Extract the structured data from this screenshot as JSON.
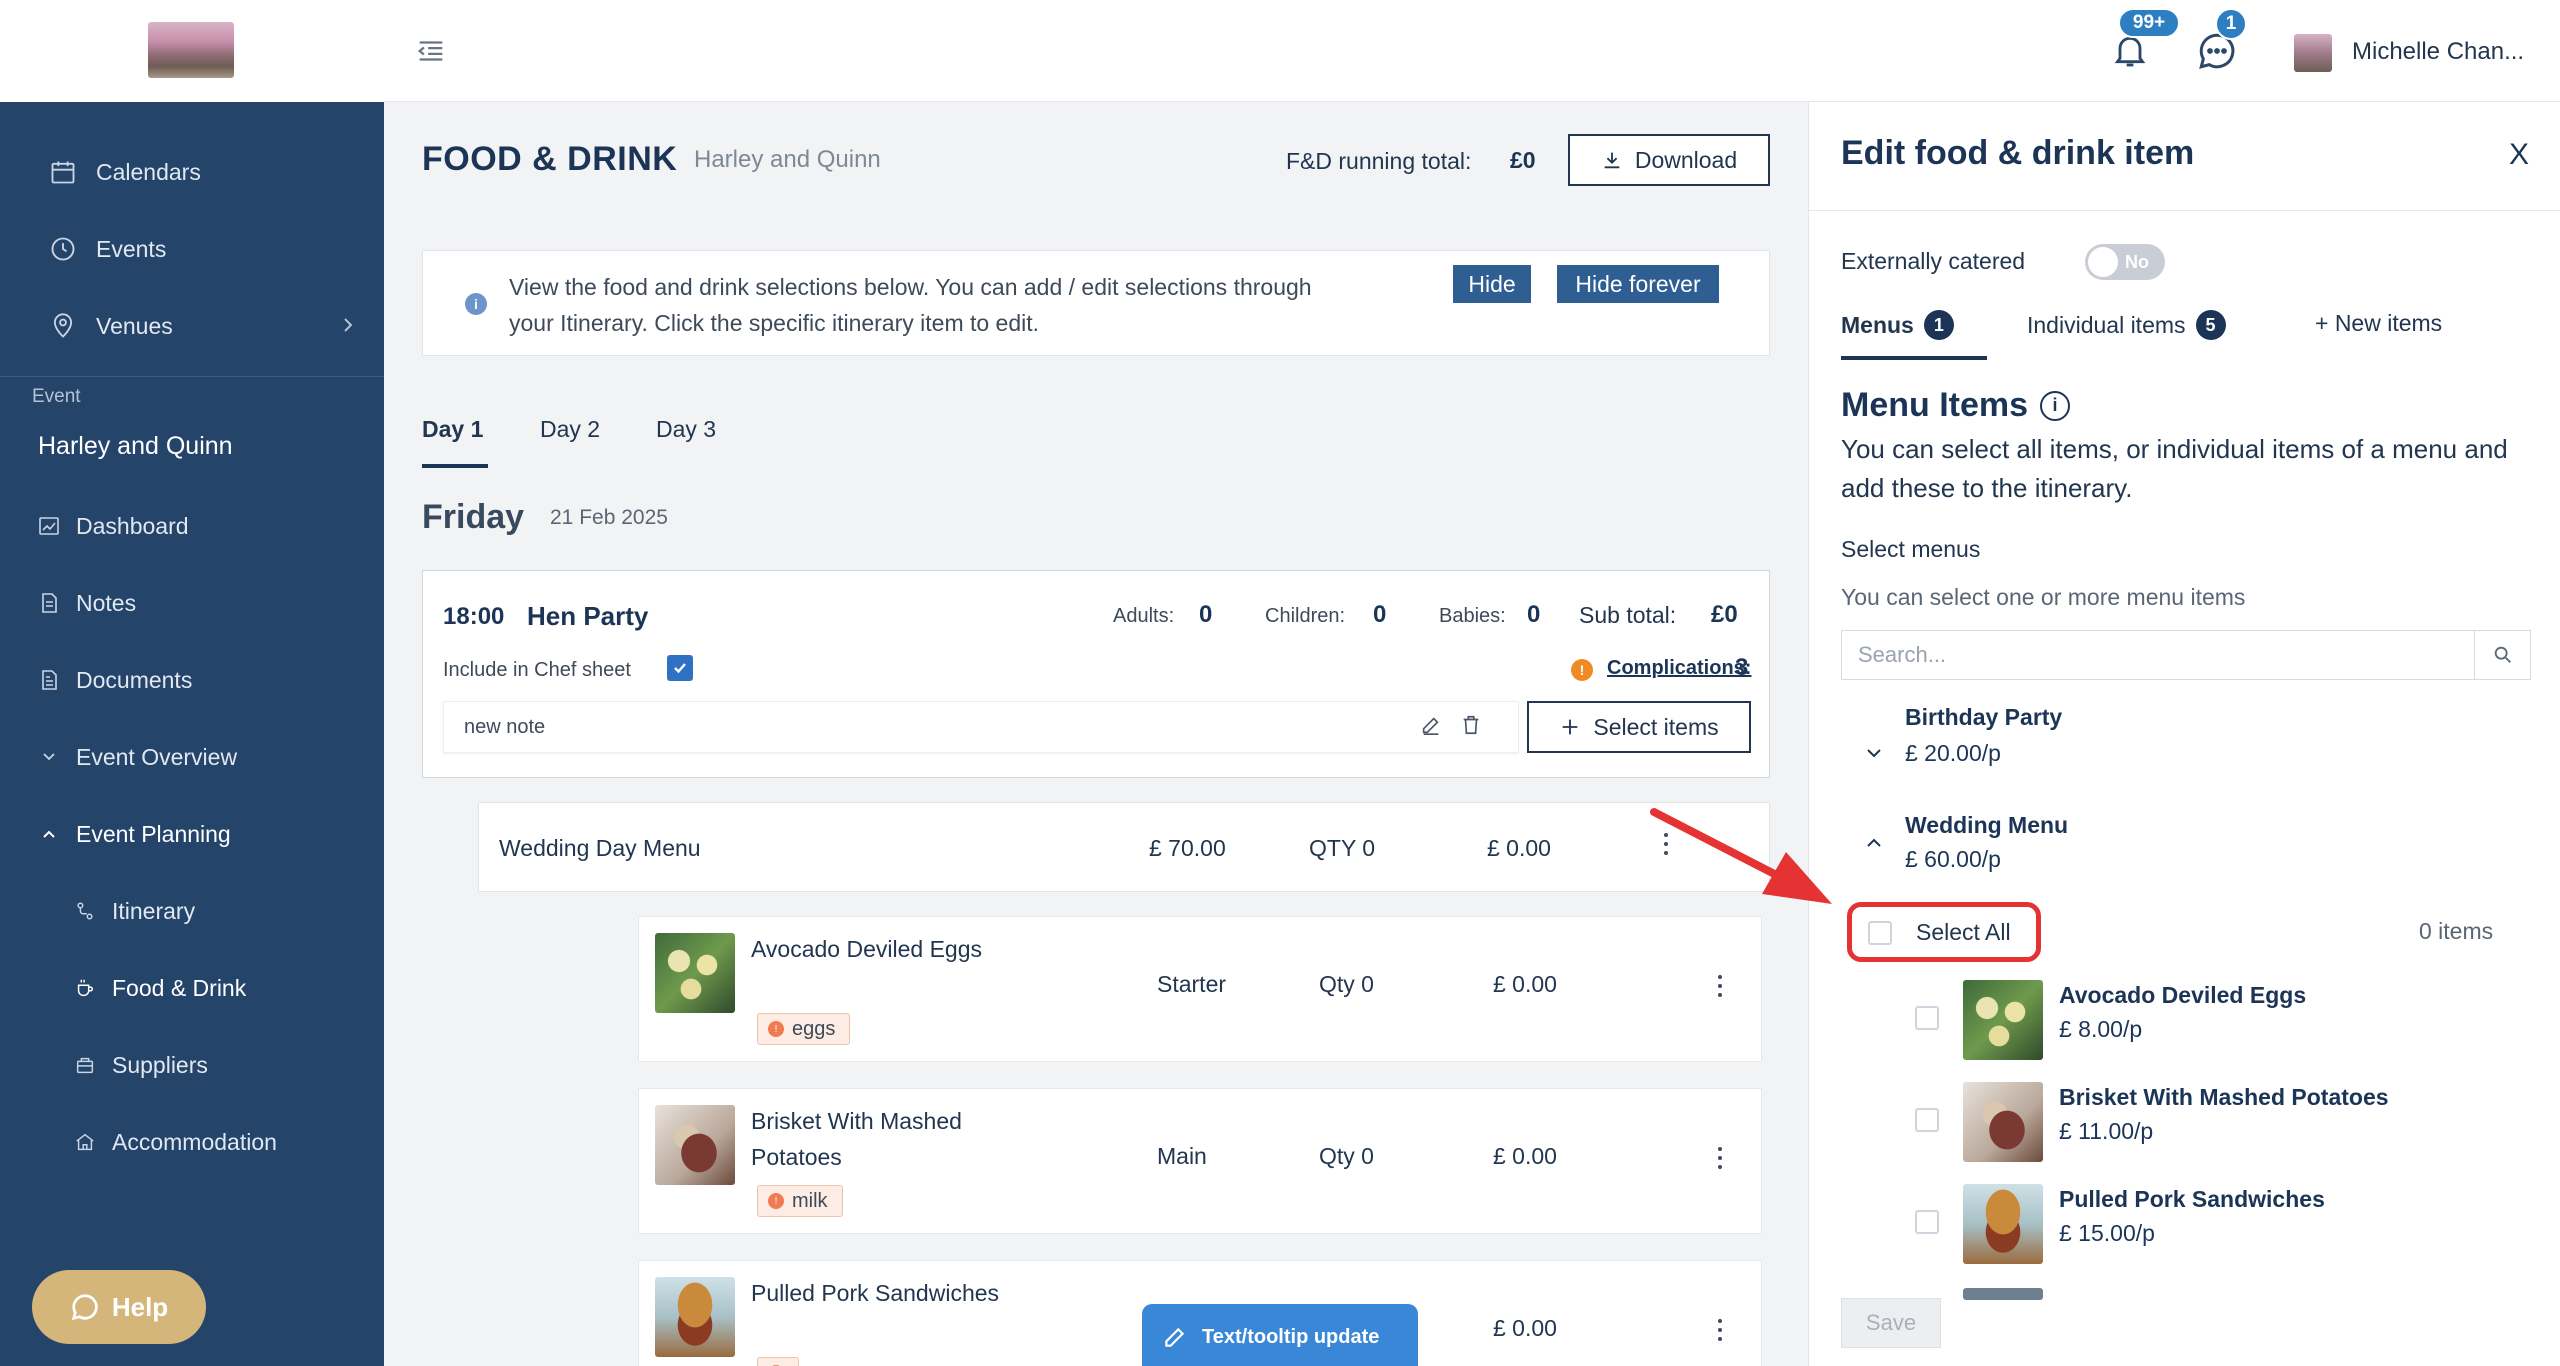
{
  "sidebar": {
    "nav": [
      {
        "label": "Calendars",
        "icon": "calendar-icon"
      },
      {
        "label": "Events",
        "icon": "events-icon"
      },
      {
        "label": "Venues",
        "icon": "location-pin-icon"
      }
    ],
    "event_label": "Event",
    "event_name": "Harley and Quinn",
    "event_nav": [
      {
        "label": "Dashboard",
        "icon": "dashboard-icon"
      },
      {
        "label": "Notes",
        "icon": "notes-icon"
      },
      {
        "label": "Documents",
        "icon": "documents-icon"
      },
      {
        "label": "Event Overview",
        "icon": "chevron-down-icon"
      },
      {
        "label": "Event Planning",
        "icon": "chevron-up-icon"
      },
      {
        "label": "Itinerary",
        "icon": "itinerary-icon"
      },
      {
        "label": "Food & Drink",
        "icon": "food-drink-icon"
      },
      {
        "label": "Suppliers",
        "icon": "suppliers-icon"
      },
      {
        "label": "Accommodation",
        "icon": "home-icon"
      }
    ],
    "help_label": "Help"
  },
  "topbar": {
    "notifications_badge": "99+",
    "messages_badge": "1",
    "user_name": "Michelle Chan..."
  },
  "main": {
    "title": "FOOD & DRINK",
    "subtitle": "Harley and Quinn",
    "running_total_label": "F&D running total:",
    "running_total_value": "£0",
    "download_label": "Download",
    "info_text": "View the food and drink selections below. You can add / edit selections through your Itinerary. Click the specific itinerary item to edit.",
    "hide_label": "Hide",
    "hide_forever_label": "Hide forever",
    "day_tabs": [
      "Day 1",
      "Day 2",
      "Day 3"
    ],
    "day_title": "Friday",
    "day_date": "21 Feb 2025",
    "event": {
      "time": "18:00",
      "name": "Hen Party",
      "adults_label": "Adults:",
      "adults_value": "0",
      "children_label": "Children:",
      "children_value": "0",
      "babies_label": "Babies:",
      "babies_value": "0",
      "subtotal_label": "Sub total:",
      "subtotal_value": "£0",
      "chef_sheet_label": "Include in Chef sheet",
      "chef_sheet_checked": true,
      "complications_label": "Complications:",
      "complications_value": "3",
      "note_text": "new note",
      "select_items_label": "Select items"
    },
    "menu": {
      "name": "Wedding Day Menu",
      "price": "£ 70.00",
      "qty": "QTY 0",
      "total": "£ 0.00"
    },
    "items": [
      {
        "name": "Avocado Deviled Eggs",
        "allergen": "eggs",
        "course": "Starter",
        "qty": "Qty 0",
        "total": "£ 0.00"
      },
      {
        "name": "Brisket With Mashed Potatoes",
        "allergen": "milk",
        "course": "Main",
        "qty": "Qty 0",
        "total": "£ 0.00"
      },
      {
        "name": "Pulled Pork Sandwiches",
        "allergen": "",
        "course": "",
        "qty": "",
        "total": "£ 0.00"
      }
    ],
    "tooltip_update_label": "Text/tooltip update"
  },
  "panel": {
    "title": "Edit food & drink item",
    "close_label": "X",
    "externally_catered_label": "Externally catered",
    "toggle_text": "No",
    "tabs": [
      {
        "label": "Menus",
        "badge": "1"
      },
      {
        "label": "Individual items",
        "badge": "5"
      },
      {
        "label": "+ New items",
        "badge": ""
      }
    ],
    "menu_items_title": "Menu Items",
    "menu_items_desc": "You can select all items, or individual items of a menu and add these to the itinerary.",
    "select_menus_label": "Select menus",
    "select_menus_hint": "You can select one or more menu items",
    "search_placeholder": "Search...",
    "menus": [
      {
        "name": "Birthday Party",
        "price": "£ 20.00/p"
      },
      {
        "name": "Wedding Menu",
        "price": "£ 60.00/p"
      }
    ],
    "select_all_label": "Select All",
    "items_count": "0 items",
    "menu_items": [
      {
        "name": "Avocado Deviled Eggs",
        "price": "£ 8.00/p"
      },
      {
        "name": "Brisket With Mashed Potatoes",
        "price": "£ 11.00/p"
      },
      {
        "name": "Pulled Pork Sandwiches",
        "price": "£ 15.00/p"
      }
    ],
    "save_label": "Save"
  },
  "colors": {
    "sidebar_bg": "#24446a",
    "primary": "#1c3557",
    "button_blue": "#2f5e93",
    "badge_blue": "#2d7fc1",
    "annotation_red": "#e53232",
    "help_gold": "#d4b57a"
  }
}
